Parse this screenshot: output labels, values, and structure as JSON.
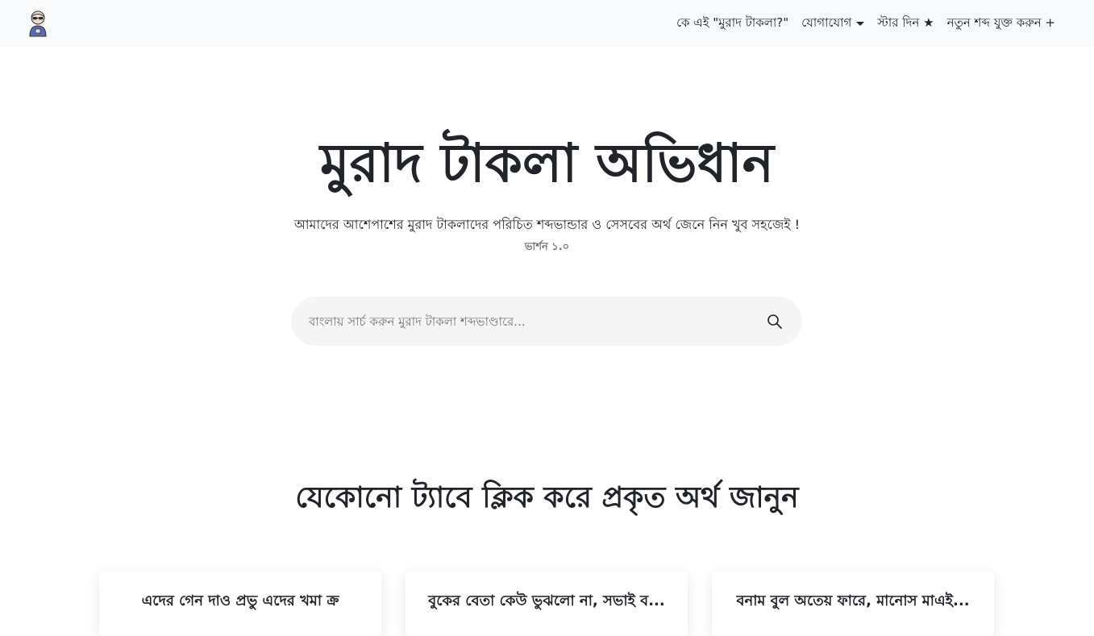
{
  "navbar": {
    "brand_icon": "avatar-logo-icon",
    "links": [
      {
        "label": "কে এই \"মুরাদ টাকলা?\""
      },
      {
        "label": "যোগাযোগ",
        "has_dropdown": true
      },
      {
        "label": "স্টার দিন ★"
      },
      {
        "label": "নতুন শব্দ যুক্ত করুন +"
      }
    ]
  },
  "hero": {
    "title": "মুরাদ টাকলা অভিধান",
    "subtitle": "আমাদের আশেপাশের মুরাদ টাকলাদের পরিচিত শব্দভান্ডার ও সেসবের অর্থ জেনে নিন খুব সহজেই !",
    "version": "ভার্শন ১.০"
  },
  "search": {
    "placeholder": "বাংলায় সার্চ করুন মুরাদ টাকলা শব্দভাণ্ডারে...",
    "value": "",
    "icon": "search-icon"
  },
  "section": {
    "title": "যেকোনো ট্যাবে ক্লিক করে প্রকৃত অর্থ জানুন"
  },
  "cards": [
    {
      "title": "এদের গেন দাও প্রভু এদের খমা ক্র"
    },
    {
      "title": "বুকের বেতা কেউ ভুঝলো না, সভাই ব..."
    },
    {
      "title": "বনাম বুল অতেয় ফারে, মানোস মাএই..."
    }
  ],
  "colors": {
    "navbar_bg": "#f8f9fa",
    "text": "#212529",
    "muted": "#6c757d",
    "search_bg": "#f5f5f5"
  }
}
